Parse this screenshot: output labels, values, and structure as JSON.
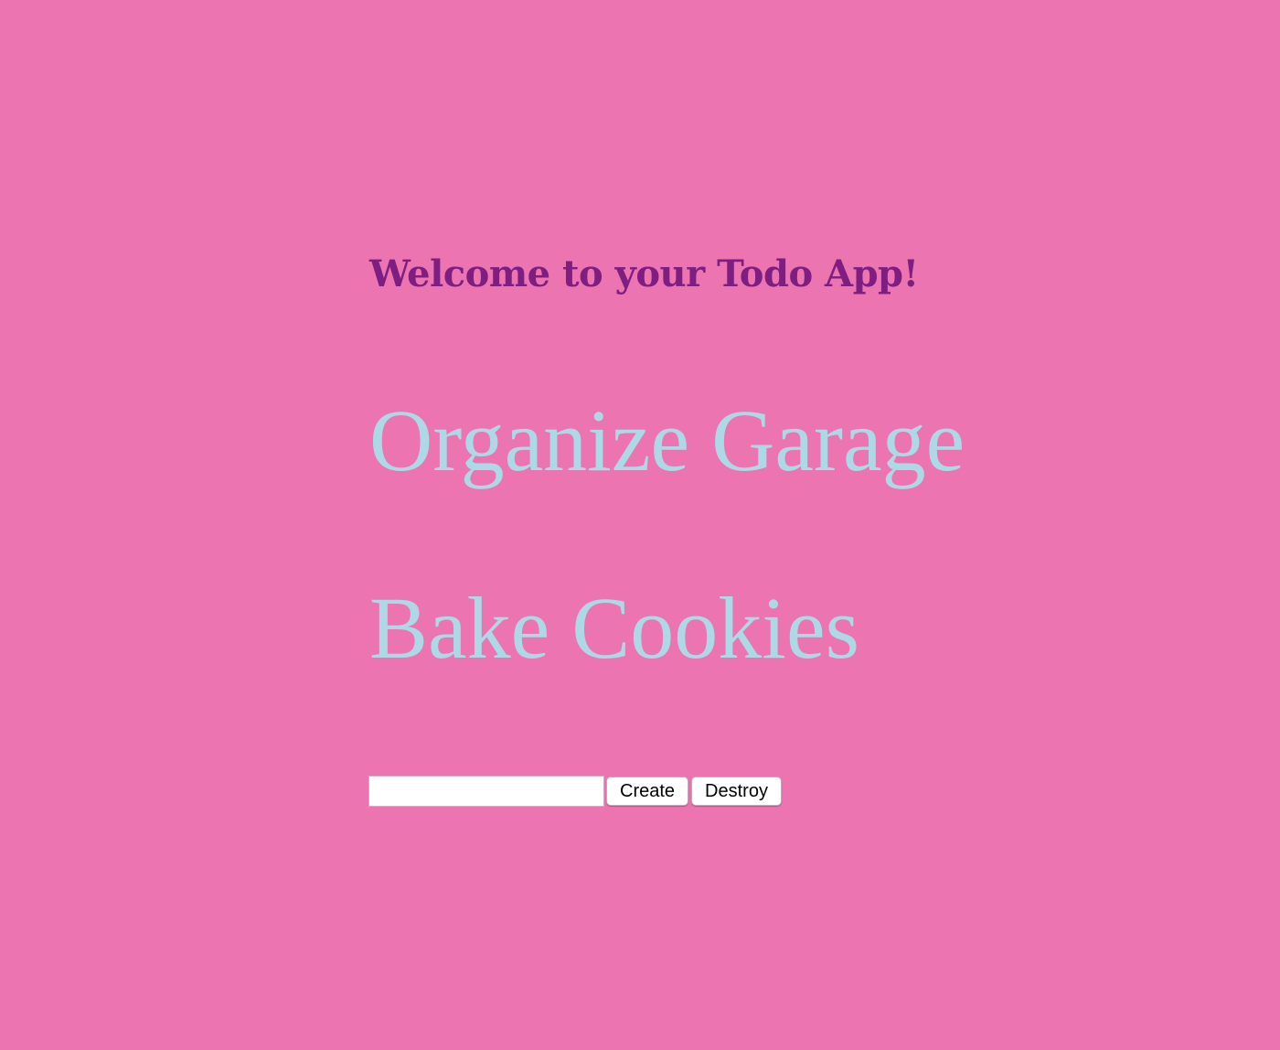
{
  "app": {
    "title": "Welcome to your Todo App!"
  },
  "todos": [
    {
      "label": "Organize Garage"
    },
    {
      "label": "Bake Cookies"
    }
  ],
  "form": {
    "input_value": "",
    "input_placeholder": "",
    "create_label": "Create",
    "destroy_label": "Destroy"
  },
  "colors": {
    "background": "#ec74b0",
    "title": "#7d1e80",
    "todo_text": "#add8e6"
  }
}
